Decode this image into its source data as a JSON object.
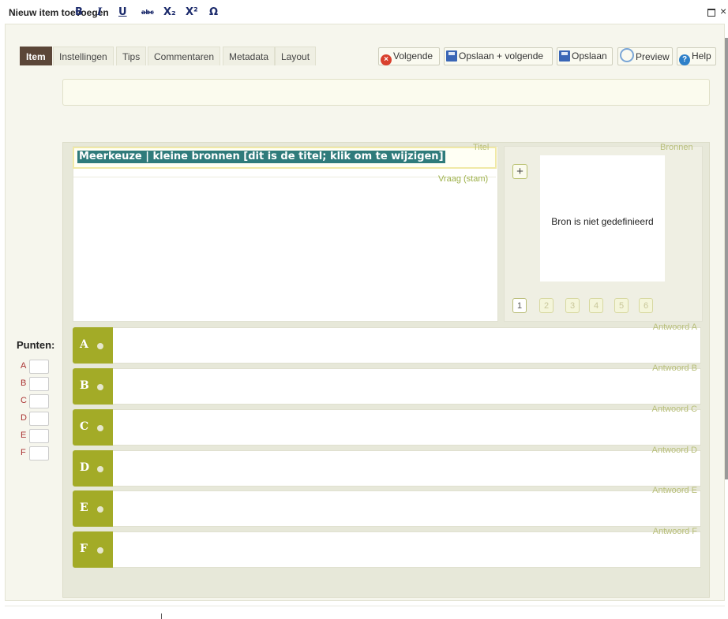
{
  "window": {
    "title": "Nieuw item toevoegen"
  },
  "tabs": [
    {
      "label": "Item",
      "active": true
    },
    {
      "label": "Instellingen"
    },
    {
      "label": "Tips"
    },
    {
      "label": "Commentaren"
    },
    {
      "label": "Metadata"
    },
    {
      "label": "Layout"
    }
  ],
  "toolbar": {
    "volgende": "Volgende",
    "opslaan_volgende": "Opslaan + volgende",
    "opslaan": "Opslaan",
    "preview": "Preview",
    "help": "Help"
  },
  "format": {
    "bold": "B",
    "italic": "I",
    "underline": "U",
    "strike": "abc",
    "sub": "X₂",
    "sup": "X²",
    "special": "Ω"
  },
  "question": {
    "titel_label": "Titel",
    "title": "Meerkeuze | kleine bronnen [dit is de titel; klik om te wijzigen]",
    "stem_label": "Vraag (stam)"
  },
  "sources": {
    "label": "Bronnen",
    "add": "+",
    "empty_text": "Bron is niet gedefinieerd",
    "pages": [
      "1",
      "2",
      "3",
      "4",
      "5",
      "6"
    ]
  },
  "points": {
    "label": "Punten:",
    "letters": [
      "A",
      "B",
      "C",
      "D",
      "E",
      "F"
    ]
  },
  "answers": [
    {
      "letter": "A",
      "label": "Antwoord A"
    },
    {
      "letter": "B",
      "label": "Antwoord B"
    },
    {
      "letter": "C",
      "label": "Antwoord C"
    },
    {
      "letter": "D",
      "label": "Antwoord D"
    },
    {
      "letter": "E",
      "label": "Antwoord E"
    },
    {
      "letter": "F",
      "label": "Antwoord F"
    }
  ],
  "colors": {
    "accent": "#a3ab27",
    "tab_active": "#5b4638",
    "title_highlight": "#2f7b7b"
  }
}
